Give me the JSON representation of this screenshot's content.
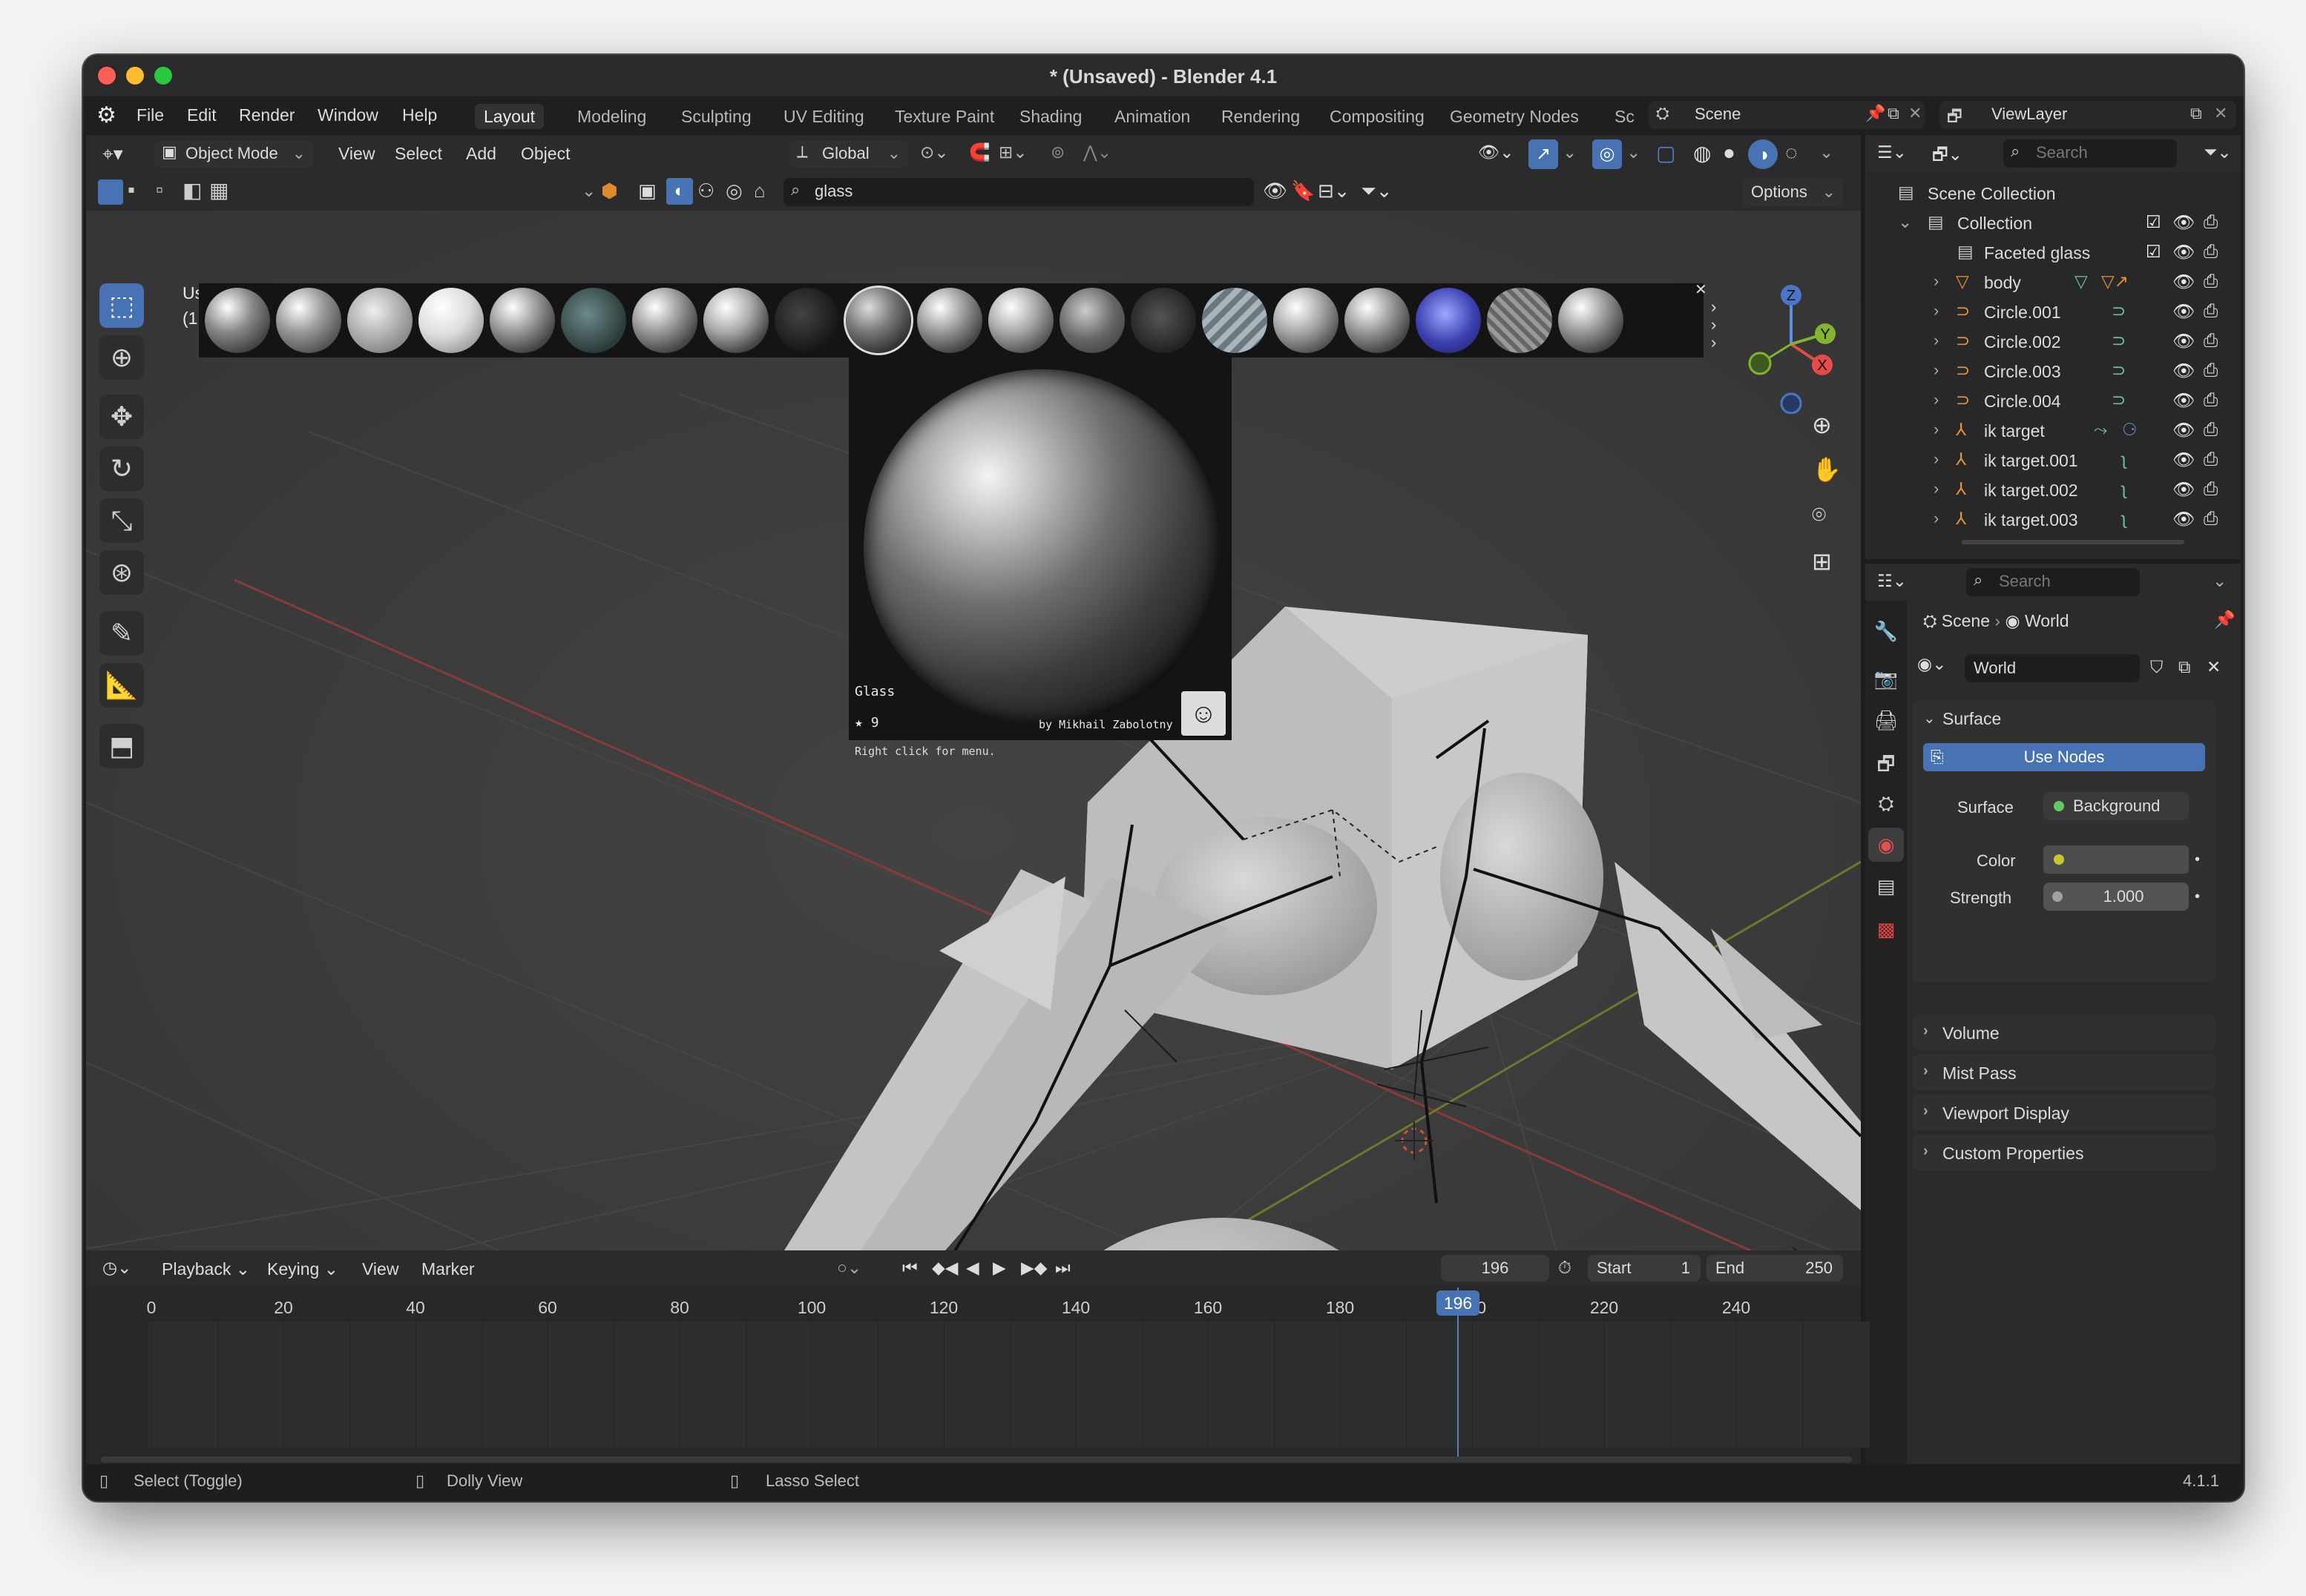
{
  "window": {
    "title": "* (Unsaved) - Blender 4.1"
  },
  "menu": {
    "file": "File",
    "edit": "Edit",
    "render": "Render",
    "window": "Window",
    "help": "Help"
  },
  "workspaces": [
    "Layout",
    "Modeling",
    "Sculpting",
    "UV Editing",
    "Texture Paint",
    "Shading",
    "Animation",
    "Rendering",
    "Compositing",
    "Geometry Nodes",
    "Sc"
  ],
  "scene_selector": "Scene",
  "view_layer_selector": "ViewLayer",
  "viewport_header": {
    "mode": "Object Mode",
    "view": "View",
    "select": "Select",
    "add": "Add",
    "object": "Object",
    "orientation": "Global",
    "options": "Options"
  },
  "asset_search": {
    "value": "glass"
  },
  "viewport_overlay_text": {
    "line1": "Us",
    "line2": "(1"
  },
  "asset_tooltip": {
    "name": "Glass",
    "stars": "9",
    "author": "by Mikhail Zabolotny",
    "hint": "Right click for menu."
  },
  "outliner": {
    "search_placeholder": "Search",
    "scene_collection": "Scene Collection",
    "collection": "Collection",
    "items": [
      {
        "name": "Faceted glass"
      },
      {
        "name": "body"
      },
      {
        "name": "Circle.001"
      },
      {
        "name": "Circle.002"
      },
      {
        "name": "Circle.003"
      },
      {
        "name": "Circle.004"
      },
      {
        "name": "ik target"
      },
      {
        "name": "ik target.001"
      },
      {
        "name": "ik target.002"
      },
      {
        "name": "ik target.003"
      }
    ]
  },
  "properties": {
    "search_placeholder": "Search",
    "breadcrumb_scene": "Scene",
    "breadcrumb_world": "World",
    "world_name": "World",
    "surface_section": "Surface",
    "use_nodes": "Use Nodes",
    "surface_label": "Surface",
    "surface_value": "Background",
    "color_label": "Color",
    "strength_label": "Strength",
    "strength_value": "1.000",
    "sections": [
      "Volume",
      "Mist Pass",
      "Viewport Display",
      "Custom Properties"
    ]
  },
  "timeline": {
    "playback": "Playback",
    "keying": "Keying",
    "view": "View",
    "marker": "Marker",
    "current_frame": "196",
    "start_label": "Start",
    "start_value": "1",
    "end_label": "End",
    "end_value": "250",
    "ticks": [
      "0",
      "20",
      "40",
      "60",
      "80",
      "100",
      "120",
      "140",
      "160",
      "180",
      "200",
      "220",
      "240"
    ],
    "playhead_label": "196"
  },
  "statusbar": {
    "select": "Select (Toggle)",
    "dolly": "Dolly View",
    "lasso": "Lasso Select",
    "version": "4.1.1"
  },
  "gizmo": {
    "z": "Z",
    "x": "X",
    "y": "Y"
  }
}
